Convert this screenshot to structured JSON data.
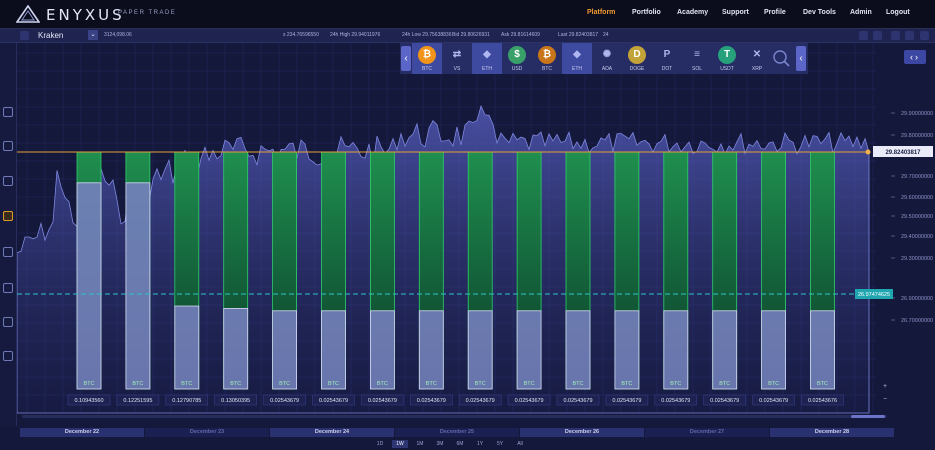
{
  "brand": {
    "name": "ENYXUS",
    "sub": "PAPER TRADE"
  },
  "nav": [
    "Platform",
    "Portfolio",
    "Academy",
    "Support",
    "Profile",
    "Dev Tools",
    "Admin",
    "Logout"
  ],
  "nav_active": "Platform",
  "ticker": {
    "exchange": "Kraken",
    "balance": "3124,098.06",
    "items": [
      "s 234.76596550",
      "24h High 29.94011976",
      "24h Low 29.75638836",
      "Bid 29.80626931",
      "Ask 29.81614609",
      "Last 29.82403817",
      "24"
    ]
  },
  "coins": [
    {
      "symbol": "BTC",
      "glyph": "₿",
      "color": "#f2931a",
      "sel": true
    },
    {
      "symbol": "VS",
      "glyph": "⇄",
      "color": "transparent",
      "sel": false
    },
    {
      "symbol": "ETH",
      "glyph": "◆",
      "color": "transparent",
      "sel": true
    },
    {
      "symbol": "USD",
      "glyph": "$",
      "color": "#3aa06a",
      "sel": false
    },
    {
      "symbol": "BTC",
      "glyph": "₿",
      "color": "#c9761a",
      "sel": false
    },
    {
      "symbol": "ETH",
      "glyph": "◆",
      "color": "transparent",
      "sel": true
    },
    {
      "symbol": "ADA",
      "glyph": "✺",
      "color": "transparent",
      "sel": false
    },
    {
      "symbol": "DOGE",
      "glyph": "D",
      "color": "#c2a33a",
      "sel": false
    },
    {
      "symbol": "DOT",
      "glyph": "P",
      "color": "transparent",
      "sel": false
    },
    {
      "symbol": "SOL",
      "glyph": "≡",
      "color": "transparent",
      "sel": false
    },
    {
      "symbol": "USDT",
      "glyph": "T",
      "color": "#26a17b",
      "sel": false
    },
    {
      "symbol": "XRP",
      "glyph": "✕",
      "color": "transparent",
      "sel": false
    }
  ],
  "chart_data": {
    "type": "bar",
    "price_lines": {
      "last": "29.82403817",
      "marker": "26.97474625"
    },
    "y_ticks": [
      "29.90000000",
      "29.80000000",
      "29.70000000",
      "29.60000000",
      "29.50000000",
      "29.40000000",
      "29.30000000",
      "26.90000000",
      "26.70000000"
    ],
    "bar_label": "BTC",
    "bars": [
      {
        "label": "BTC",
        "value": "0.10943560",
        "fill": 0.87
      },
      {
        "label": "BTC",
        "value": "0.12251595",
        "fill": 0.87
      },
      {
        "label": "BTC",
        "value": "0.12790785",
        "fill": 0.35
      },
      {
        "label": "BTC",
        "value": "0.13050395",
        "fill": 0.34
      },
      {
        "label": "BTC",
        "value": "0.02543679",
        "fill": 0.33
      },
      {
        "label": "BTC",
        "value": "0.02543679",
        "fill": 0.33
      },
      {
        "label": "BTC",
        "value": "0.02543679",
        "fill": 0.33
      },
      {
        "label": "BTC",
        "value": "0.02543679",
        "fill": 0.33
      },
      {
        "label": "BTC",
        "value": "0.02543679",
        "fill": 0.33
      },
      {
        "label": "BTC",
        "value": "0.02543679",
        "fill": 0.33
      },
      {
        "label": "BTC",
        "value": "0.02543679",
        "fill": 0.33
      },
      {
        "label": "BTC",
        "value": "0.02543679",
        "fill": 0.33
      },
      {
        "label": "BTC",
        "value": "0.02543679",
        "fill": 0.33
      },
      {
        "label": "BTC",
        "value": "0.02543679",
        "fill": 0.33
      },
      {
        "label": "BTC",
        "value": "0.02543679",
        "fill": 0.33
      },
      {
        "label": "BTC",
        "value": "0.02543676",
        "fill": 0.33
      }
    ]
  },
  "dates": [
    "December 22",
    "December 23",
    "December 24",
    "December 25",
    "December 26",
    "December 27",
    "December 28"
  ],
  "ranges": [
    "1D",
    "1W",
    "1M",
    "3M",
    "6M",
    "1Y",
    "5Y",
    "All"
  ],
  "range_active": "1W",
  "colors": {
    "accent": "#f29a2e",
    "green": "#2fd06a",
    "bar_base": "#8a90cf",
    "cyan": "#36c4c8"
  }
}
